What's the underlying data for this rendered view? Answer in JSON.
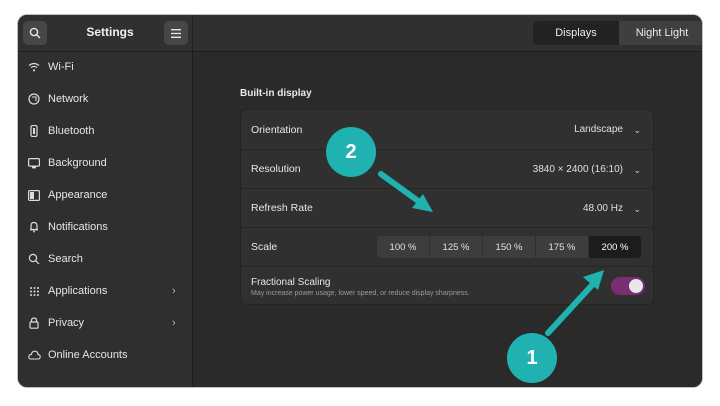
{
  "header": {
    "title": "Settings",
    "tabs": [
      {
        "label": "Displays"
      },
      {
        "label": "Night Light"
      }
    ]
  },
  "sidebar": {
    "items": [
      {
        "label": "Wi-Fi",
        "icon": "wifi-icon"
      },
      {
        "label": "Network",
        "icon": "network-icon"
      },
      {
        "label": "Bluetooth",
        "icon": "bluetooth-icon"
      },
      {
        "label": "Background",
        "icon": "background-icon"
      },
      {
        "label": "Appearance",
        "icon": "appearance-icon"
      },
      {
        "label": "Notifications",
        "icon": "bell-icon"
      },
      {
        "label": "Search",
        "icon": "search-icon"
      },
      {
        "label": "Applications",
        "icon": "grid-icon",
        "chevron": "›"
      },
      {
        "label": "Privacy",
        "icon": "lock-icon",
        "chevron": "›"
      },
      {
        "label": "Online Accounts",
        "icon": "cloud-icon"
      }
    ]
  },
  "main": {
    "section_title": "Built-in display",
    "orientation": {
      "label": "Orientation",
      "value": "Landscape"
    },
    "resolution": {
      "label": "Resolution",
      "value": "3840 × 2400 (16:10)"
    },
    "refresh_rate": {
      "label": "Refresh Rate",
      "value": "48.00 Hz"
    },
    "scale": {
      "label": "Scale",
      "options": [
        "100 %",
        "125 %",
        "150 %",
        "175 %",
        "200 %"
      ],
      "selected": "200 %"
    },
    "fractional_scaling": {
      "label": "Fractional Scaling",
      "description": "May increase power usage, lower speed, or reduce display sharpness.",
      "enabled": true
    }
  },
  "annotations": {
    "badge1": "1",
    "badge2": "2"
  },
  "colors": {
    "accent_toggle": "#7b2d73",
    "annotation": "#1fb2b0",
    "close_button": "#e95420"
  }
}
